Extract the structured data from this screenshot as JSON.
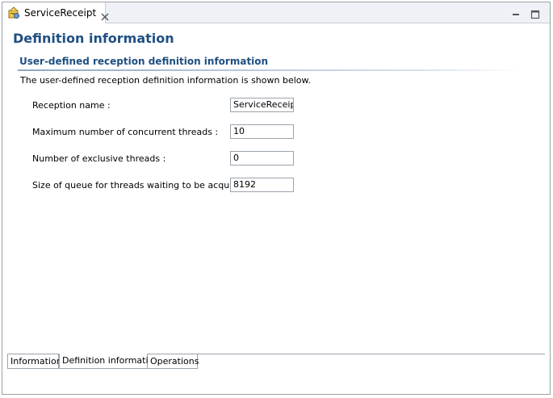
{
  "editor": {
    "tab_label": "ServiceReceipt",
    "tab_icon": "service-receipt-icon"
  },
  "page": {
    "title": "Definition information"
  },
  "section": {
    "title": "User-defined reception definition information",
    "description": "The user-defined reception definition information is shown below."
  },
  "fields": {
    "reception_name": {
      "label": "Reception name :",
      "value": "ServiceReceipt"
    },
    "max_threads": {
      "label": "Maximum number of concurrent threads :",
      "value": "10"
    },
    "exclusive_threads": {
      "label": "Number of exclusive threads :",
      "value": "0"
    },
    "queue_size": {
      "label": "Size of queue for threads waiting to be acquired :",
      "value": "8192"
    }
  },
  "bottom_tabs": {
    "information": "Information",
    "definition_information": "Definition information",
    "operations": "Operations"
  },
  "colors": {
    "heading": "#1f4f82",
    "border": "#9aa3ad"
  }
}
